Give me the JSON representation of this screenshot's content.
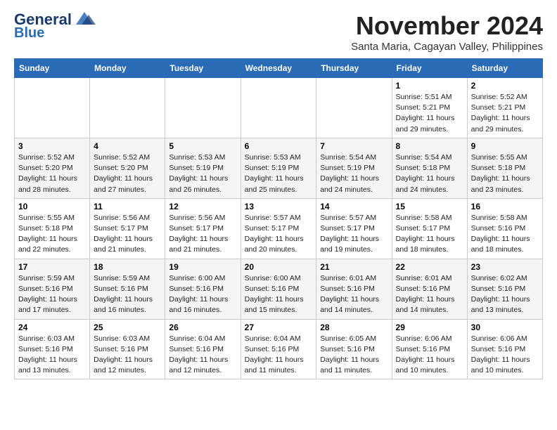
{
  "logo": {
    "line1": "General",
    "line2": "Blue"
  },
  "title": "November 2024",
  "subtitle": "Santa Maria, Cagayan Valley, Philippines",
  "days_of_week": [
    "Sunday",
    "Monday",
    "Tuesday",
    "Wednesday",
    "Thursday",
    "Friday",
    "Saturday"
  ],
  "weeks": [
    [
      {
        "day": "",
        "info": ""
      },
      {
        "day": "",
        "info": ""
      },
      {
        "day": "",
        "info": ""
      },
      {
        "day": "",
        "info": ""
      },
      {
        "day": "",
        "info": ""
      },
      {
        "day": "1",
        "info": "Sunrise: 5:51 AM\nSunset: 5:21 PM\nDaylight: 11 hours\nand 29 minutes."
      },
      {
        "day": "2",
        "info": "Sunrise: 5:52 AM\nSunset: 5:21 PM\nDaylight: 11 hours\nand 29 minutes."
      }
    ],
    [
      {
        "day": "3",
        "info": "Sunrise: 5:52 AM\nSunset: 5:20 PM\nDaylight: 11 hours\nand 28 minutes."
      },
      {
        "day": "4",
        "info": "Sunrise: 5:52 AM\nSunset: 5:20 PM\nDaylight: 11 hours\nand 27 minutes."
      },
      {
        "day": "5",
        "info": "Sunrise: 5:53 AM\nSunset: 5:19 PM\nDaylight: 11 hours\nand 26 minutes."
      },
      {
        "day": "6",
        "info": "Sunrise: 5:53 AM\nSunset: 5:19 PM\nDaylight: 11 hours\nand 25 minutes."
      },
      {
        "day": "7",
        "info": "Sunrise: 5:54 AM\nSunset: 5:19 PM\nDaylight: 11 hours\nand 24 minutes."
      },
      {
        "day": "8",
        "info": "Sunrise: 5:54 AM\nSunset: 5:18 PM\nDaylight: 11 hours\nand 24 minutes."
      },
      {
        "day": "9",
        "info": "Sunrise: 5:55 AM\nSunset: 5:18 PM\nDaylight: 11 hours\nand 23 minutes."
      }
    ],
    [
      {
        "day": "10",
        "info": "Sunrise: 5:55 AM\nSunset: 5:18 PM\nDaylight: 11 hours\nand 22 minutes."
      },
      {
        "day": "11",
        "info": "Sunrise: 5:56 AM\nSunset: 5:17 PM\nDaylight: 11 hours\nand 21 minutes."
      },
      {
        "day": "12",
        "info": "Sunrise: 5:56 AM\nSunset: 5:17 PM\nDaylight: 11 hours\nand 21 minutes."
      },
      {
        "day": "13",
        "info": "Sunrise: 5:57 AM\nSunset: 5:17 PM\nDaylight: 11 hours\nand 20 minutes."
      },
      {
        "day": "14",
        "info": "Sunrise: 5:57 AM\nSunset: 5:17 PM\nDaylight: 11 hours\nand 19 minutes."
      },
      {
        "day": "15",
        "info": "Sunrise: 5:58 AM\nSunset: 5:17 PM\nDaylight: 11 hours\nand 18 minutes."
      },
      {
        "day": "16",
        "info": "Sunrise: 5:58 AM\nSunset: 5:16 PM\nDaylight: 11 hours\nand 18 minutes."
      }
    ],
    [
      {
        "day": "17",
        "info": "Sunrise: 5:59 AM\nSunset: 5:16 PM\nDaylight: 11 hours\nand 17 minutes."
      },
      {
        "day": "18",
        "info": "Sunrise: 5:59 AM\nSunset: 5:16 PM\nDaylight: 11 hours\nand 16 minutes."
      },
      {
        "day": "19",
        "info": "Sunrise: 6:00 AM\nSunset: 5:16 PM\nDaylight: 11 hours\nand 16 minutes."
      },
      {
        "day": "20",
        "info": "Sunrise: 6:00 AM\nSunset: 5:16 PM\nDaylight: 11 hours\nand 15 minutes."
      },
      {
        "day": "21",
        "info": "Sunrise: 6:01 AM\nSunset: 5:16 PM\nDaylight: 11 hours\nand 14 minutes."
      },
      {
        "day": "22",
        "info": "Sunrise: 6:01 AM\nSunset: 5:16 PM\nDaylight: 11 hours\nand 14 minutes."
      },
      {
        "day": "23",
        "info": "Sunrise: 6:02 AM\nSunset: 5:16 PM\nDaylight: 11 hours\nand 13 minutes."
      }
    ],
    [
      {
        "day": "24",
        "info": "Sunrise: 6:03 AM\nSunset: 5:16 PM\nDaylight: 11 hours\nand 13 minutes."
      },
      {
        "day": "25",
        "info": "Sunrise: 6:03 AM\nSunset: 5:16 PM\nDaylight: 11 hours\nand 12 minutes."
      },
      {
        "day": "26",
        "info": "Sunrise: 6:04 AM\nSunset: 5:16 PM\nDaylight: 11 hours\nand 12 minutes."
      },
      {
        "day": "27",
        "info": "Sunrise: 6:04 AM\nSunset: 5:16 PM\nDaylight: 11 hours\nand 11 minutes."
      },
      {
        "day": "28",
        "info": "Sunrise: 6:05 AM\nSunset: 5:16 PM\nDaylight: 11 hours\nand 11 minutes."
      },
      {
        "day": "29",
        "info": "Sunrise: 6:06 AM\nSunset: 5:16 PM\nDaylight: 11 hours\nand 10 minutes."
      },
      {
        "day": "30",
        "info": "Sunrise: 6:06 AM\nSunset: 5:16 PM\nDaylight: 11 hours\nand 10 minutes."
      }
    ]
  ]
}
